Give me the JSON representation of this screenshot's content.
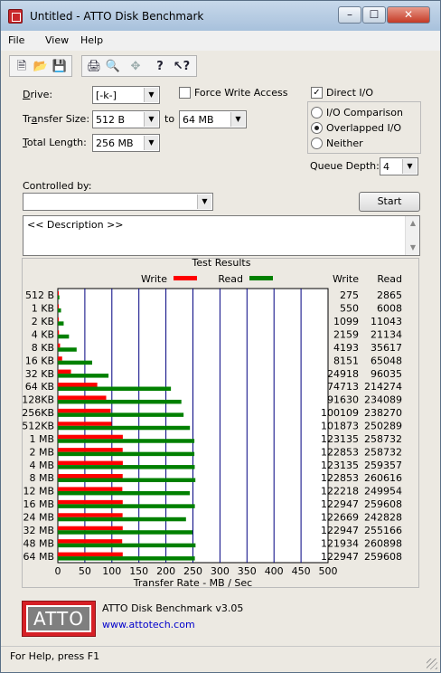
{
  "window": {
    "title": "Untitled - ATTO Disk Benchmark",
    "controls": {
      "minimize": "–",
      "maximize": "☐",
      "close": "✕"
    }
  },
  "menu": [
    "File",
    "View",
    "Help"
  ],
  "toolbar": {
    "icons": [
      "new-icon",
      "open-icon",
      "save-icon",
      "print-icon",
      "print-preview-icon",
      "move-icon",
      "help-icon",
      "context-help-icon"
    ]
  },
  "form": {
    "drive_label": "Drive:",
    "drive_value": "[-k-]",
    "force_write_label": "Force Write Access",
    "force_write_checked": false,
    "direct_io_label": "Direct I/O",
    "direct_io_checked": true,
    "transfer_size_label": "Transfer Size:",
    "transfer_from": "512 B",
    "to_label": "to",
    "transfer_to": "64 MB",
    "total_length_label": "Total Length:",
    "total_length_value": "256 MB",
    "io_modes": [
      {
        "label": "I/O Comparison",
        "selected": false
      },
      {
        "label": "Overlapped I/O",
        "selected": true
      },
      {
        "label": "Neither",
        "selected": false
      }
    ],
    "queue_depth_label": "Queue Depth:",
    "queue_depth_value": "4",
    "controlled_by_label": "Controlled by:",
    "controlled_by_value": "",
    "start_label": "Start",
    "description": "<< Description >>"
  },
  "results": {
    "group_title": "Test Results",
    "write_col": "Write",
    "read_col": "Read"
  },
  "chart_data": {
    "type": "bar",
    "orientation": "horizontal",
    "xlabel": "Transfer Rate - MB / Sec",
    "xlim": [
      0,
      500
    ],
    "xticks": [
      0,
      50,
      100,
      150,
      200,
      250,
      300,
      350,
      400,
      450,
      500
    ],
    "grid": true,
    "legend": "top",
    "colors": {
      "write": "#ff0000",
      "read": "#008000"
    },
    "categories": [
      "512 B",
      "1 KB",
      "2 KB",
      "4 KB",
      "8 KB",
      "16 KB",
      "32 KB",
      "64 KB",
      "128KB",
      "256KB",
      "512KB",
      "1 MB",
      "2 MB",
      "4 MB",
      "8 MB",
      "12 MB",
      "16 MB",
      "24 MB",
      "32 MB",
      "48 MB",
      "64 MB"
    ],
    "series": [
      {
        "name": "Write",
        "values": [
          275,
          550,
          1099,
          2159,
          4193,
          8151,
          24918,
          74713,
          91630,
          100109,
          101873,
          123135,
          122853,
          123135,
          122853,
          122218,
          122947,
          122669,
          122947,
          121934,
          122947
        ]
      },
      {
        "name": "Read",
        "values": [
          2865,
          6008,
          11043,
          21134,
          35617,
          65048,
          96035,
          214274,
          234089,
          238270,
          250289,
          258732,
          258732,
          259357,
          260616,
          249954,
          259608,
          242828,
          255166,
          260898,
          259608
        ]
      }
    ]
  },
  "footer": {
    "logo_text": "ATTO",
    "product": "ATTO Disk Benchmark v3.05",
    "url": "www.attotech.com"
  },
  "status": {
    "text": "For Help, press F1"
  }
}
